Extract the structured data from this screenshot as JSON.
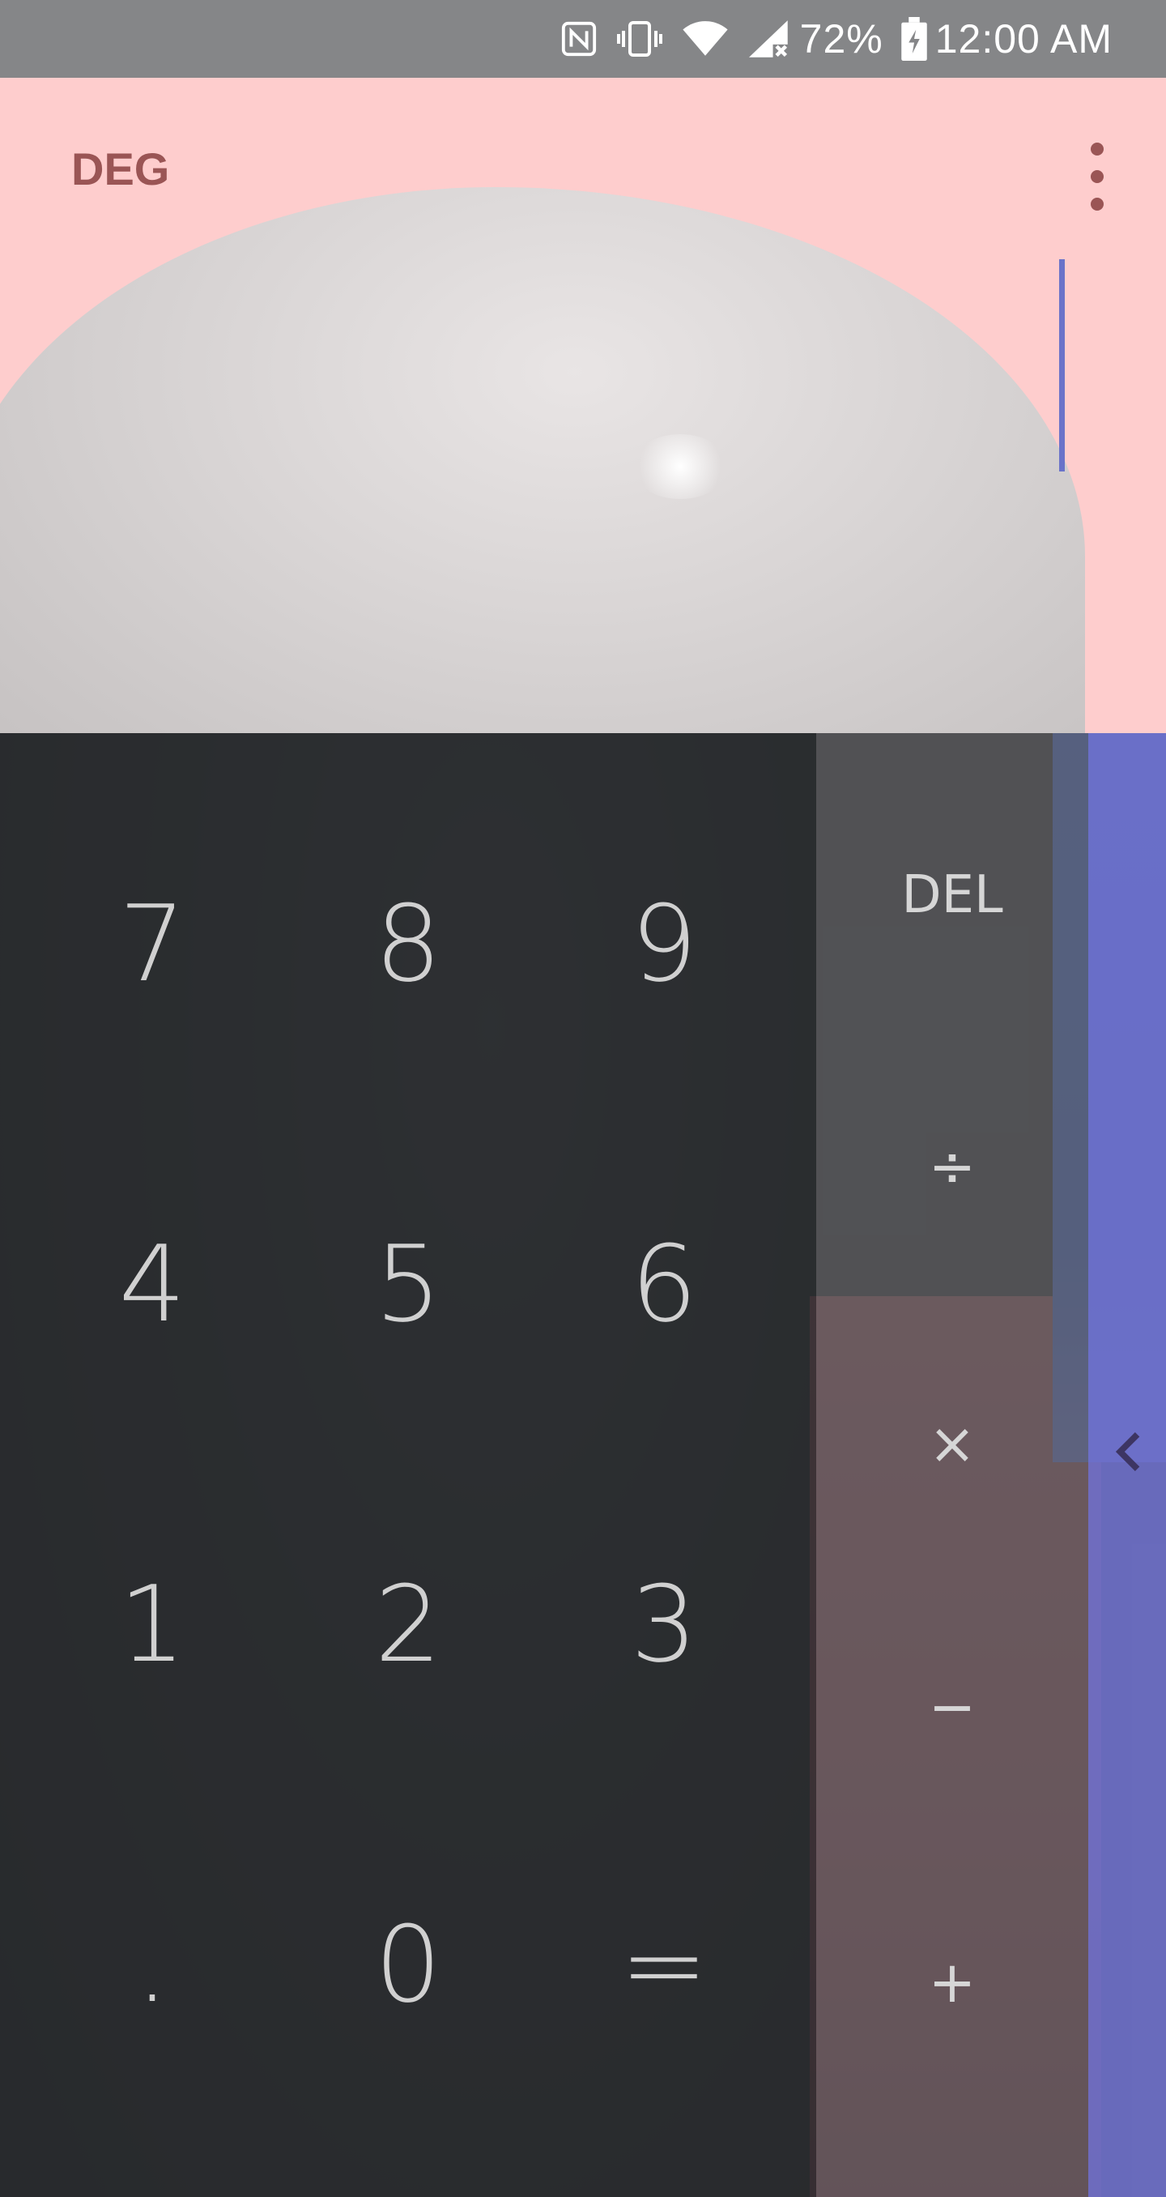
{
  "status_bar": {
    "icons": [
      "nfc-icon",
      "vibrate-icon",
      "wifi-icon",
      "signal-icon",
      "battery-charging-icon"
    ],
    "battery_percent": "72%",
    "time": "12:00 AM"
  },
  "display": {
    "angle_mode": "DEG",
    "expression": "",
    "menu_icon": "more-vert-icon"
  },
  "keypad": {
    "digits": {
      "k7": "7",
      "k8": "8",
      "k9": "9",
      "k4": "4",
      "k5": "5",
      "k6": "6",
      "k1": "1",
      "k2": "2",
      "k3": "3",
      "dot": ".",
      "k0": "0",
      "equals": "="
    },
    "operators": {
      "del": "DEL",
      "divide": "÷",
      "multiply": "×",
      "minus": "−",
      "plus": "+"
    },
    "advanced_toggle_icon": "chevron-left-icon"
  },
  "colors": {
    "status_bar_bg": "#858688",
    "display_bg": "#fecdcd",
    "accent": "#6a73c9",
    "mode_text": "#9a5555",
    "digit_text": "#d0d0d0"
  }
}
